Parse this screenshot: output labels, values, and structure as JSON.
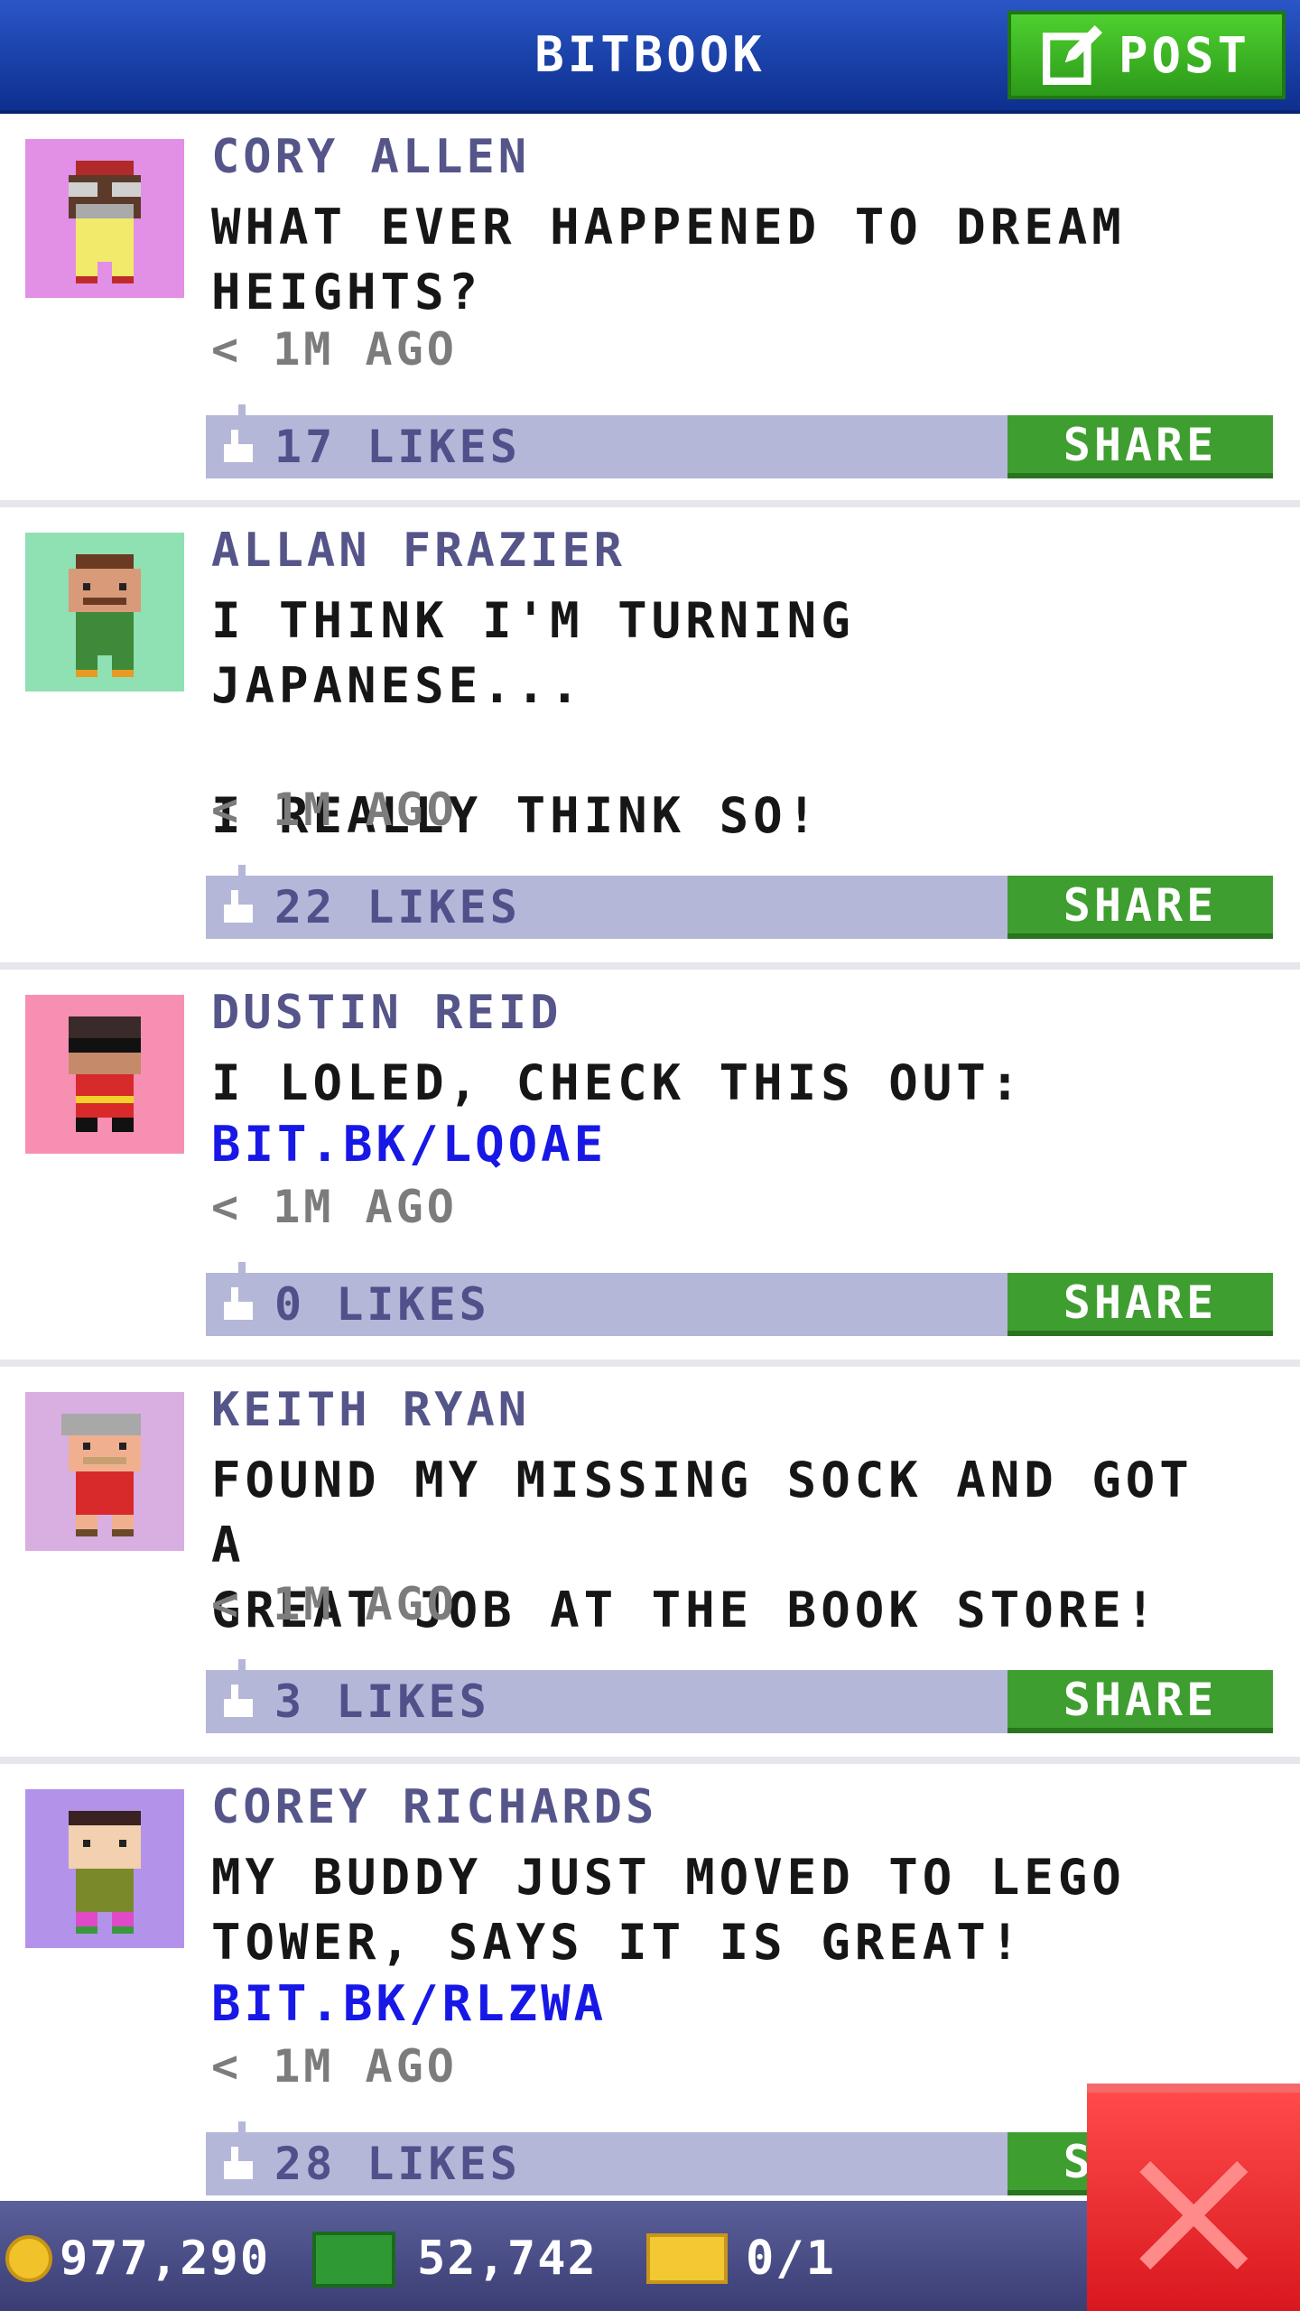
{
  "header": {
    "title": "BITBOOK",
    "post_label": "POST"
  },
  "posts": [
    {
      "author": "CORY ALLEN",
      "message": "WHAT EVER HAPPENED TO DREAM\nHEIGHTS?",
      "link": "",
      "time": "< 1M AGO",
      "likes": "17 LIKES",
      "share": "SHARE",
      "avatar_bg": "#e28fe6"
    },
    {
      "author": "ALLAN FRAZIER",
      "message": "I THINK I'M TURNING JAPANESE...\n\nI REALLY THINK SO!",
      "link": "",
      "time": "< 1M AGO",
      "likes": "22 LIKES",
      "share": "SHARE",
      "avatar_bg": "#8fe0b2"
    },
    {
      "author": "DUSTIN REID",
      "message": "I LOLED, CHECK THIS OUT:",
      "link": "BIT.BK/LQOAE",
      "time": "< 1M AGO",
      "likes": "0 LIKES",
      "share": "SHARE",
      "avatar_bg": "#f78fb2"
    },
    {
      "author": "KEITH RYAN",
      "message": "FOUND MY MISSING SOCK AND GOT A\nGREAT JOB AT THE BOOK STORE!",
      "link": "",
      "time": "< 1M AGO",
      "likes": "3 LIKES",
      "share": "SHARE",
      "avatar_bg": "#d9aee0"
    },
    {
      "author": "COREY RICHARDS",
      "message": "MY BUDDY JUST MOVED TO LEGO\nTOWER, SAYS IT IS GREAT!",
      "link": "BIT.BK/RLZWA",
      "time": "< 1M AGO",
      "likes": "28 LIKES",
      "share": "SHARE",
      "avatar_bg": "#b393ea"
    }
  ],
  "status": {
    "coins": "977,290",
    "bux": "52,742",
    "tickets": "0/1"
  },
  "colors": {
    "header": "#1e4bbf",
    "post_button": "#3fbf24",
    "share_button": "#3f9e30",
    "like_bar": "#b4b7d8",
    "link": "#1818e6",
    "close_button": "#e8242a"
  },
  "icons": {
    "post": "compose-icon",
    "like": "thumbs-up-icon",
    "coin": "coin-icon",
    "bux": "cash-icon",
    "ticket": "ticket-icon",
    "close": "close-icon"
  }
}
